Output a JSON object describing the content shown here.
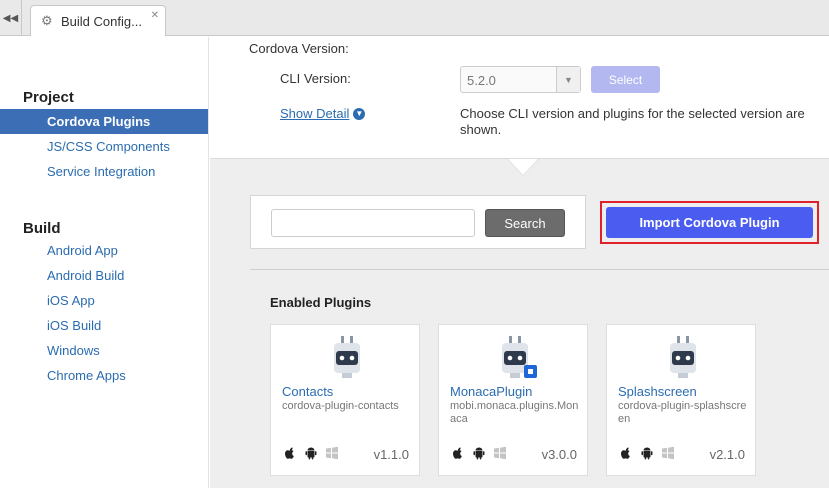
{
  "tabbar": {
    "nav_glyph": "◀◀",
    "tab_title": "Build Config...",
    "close_glyph": "✕",
    "gear_glyph": "⚙"
  },
  "sidebar": {
    "project_heading": "Project",
    "project_items": [
      {
        "label": "Cordova Plugins",
        "active": true
      },
      {
        "label": "JS/CSS Components",
        "active": false
      },
      {
        "label": "Service Integration",
        "active": false
      }
    ],
    "build_heading": "Build",
    "build_items": [
      {
        "label": "Android App"
      },
      {
        "label": "Android Build"
      },
      {
        "label": "iOS App"
      },
      {
        "label": "iOS Build"
      },
      {
        "label": "Windows"
      },
      {
        "label": "Chrome Apps"
      }
    ]
  },
  "cordova": {
    "section_label": "Cordova Version:",
    "cli_label": "CLI Version:",
    "cli_value": "5.2.0",
    "select_label": "Select",
    "show_detail": "Show Detail",
    "hint": "Choose CLI version and plugins for the selected version are shown."
  },
  "search": {
    "placeholder": "",
    "button_label": "Search"
  },
  "import_button": "Import Cordova Plugin",
  "enabled_title": "Enabled Plugins",
  "plugins": [
    {
      "name": "Contacts",
      "id": "cordova-plugin-contacts",
      "version": "v1.1.0",
      "badge": false
    },
    {
      "name": "MonacaPlugin",
      "id": "mobi.monaca.plugins.Monaca",
      "version": "v3.0.0",
      "badge": true
    },
    {
      "name": "Splashscreen",
      "id": "cordova-plugin-splashscreen",
      "version": "v2.1.0",
      "badge": false
    }
  ],
  "icons": {
    "apple": "apple-icon",
    "android": "android-icon",
    "windows": "windows-icon",
    "plugin": "plugin-plug-icon"
  },
  "colors": {
    "sidebar_active": "#3b6eb5",
    "link": "#2b6cb0",
    "import_button": "#4a5df0",
    "highlight": "#e0212a"
  }
}
